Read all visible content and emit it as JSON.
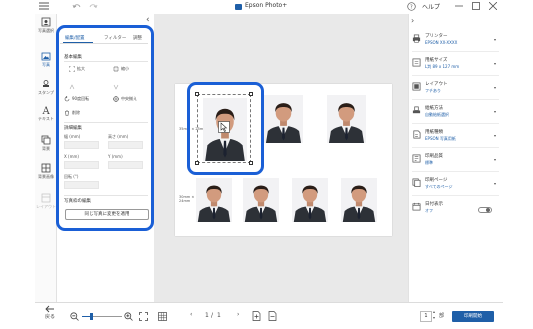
{
  "titlebar": {
    "title": "Epson Photo+",
    "help": "ヘルプ"
  },
  "left_rail": {
    "items": [
      {
        "label": "写真選択"
      },
      {
        "label": "写真"
      },
      {
        "label": "スタンプ"
      },
      {
        "label": "テキスト"
      },
      {
        "label": "背景"
      },
      {
        "label": "背景画像"
      },
      {
        "label": "レイアウト"
      }
    ]
  },
  "edit_panel": {
    "tabs": [
      "編集/配置",
      "フィルター",
      "調整"
    ],
    "basic_title": "基本編集",
    "tools": {
      "zoom_in": "拡大",
      "zoom_out": "縮小",
      "rotate": "90度回転",
      "center": "中央揃え",
      "delete": "削除"
    },
    "detail_title": "詳細編集",
    "fields": {
      "width": "幅 (mm)",
      "height": "高さ (mm)",
      "x": "X (mm)",
      "y": "Y (mm)",
      "rotation": "回転 (°)"
    },
    "frame_title": "写真枠の編集",
    "apply_button": "同じ写真に変更を適用"
  },
  "canvas": {
    "size_label_1": "35mm × 25mm",
    "size_label_2": "30mm × 24mm"
  },
  "right_panel": {
    "items": [
      {
        "title": "プリンター",
        "value": "EPSON XX-XXXX"
      },
      {
        "title": "用紙サイズ",
        "value": "L判 89 x 127 mm"
      },
      {
        "title": "レイアウト",
        "value": "フチあり"
      },
      {
        "title": "給紙方法",
        "value": "自動給紙選択"
      },
      {
        "title": "用紙種類",
        "value": "EPSON 写真用紙"
      },
      {
        "title": "印刷品質",
        "value": "標準"
      },
      {
        "title": "印刷ページ",
        "value": "すべてのページ"
      },
      {
        "title": "日付表示",
        "value": "オフ"
      }
    ]
  },
  "bottom_bar": {
    "back_label": "戻る",
    "page_current": "1",
    "page_total": "1",
    "copies": "1",
    "copies_unit": "部",
    "print_button": "印刷開始"
  },
  "colors": {
    "accent": "#1f5fa8",
    "highlight": "#1a5fd6"
  }
}
